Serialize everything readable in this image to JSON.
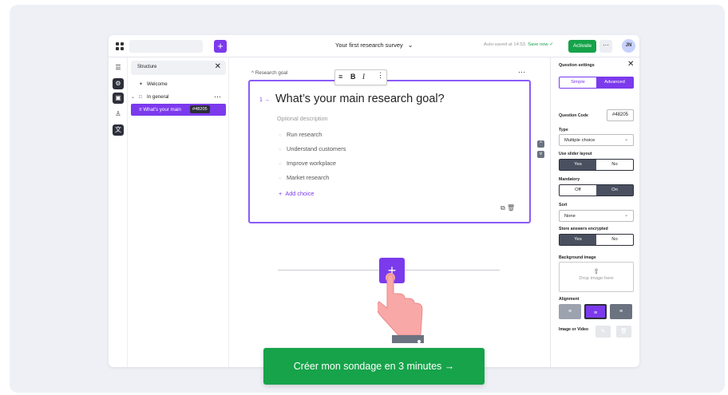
{
  "topbar": {
    "survey_title": "Your first research survey",
    "autosave": "Auto-saved at 14:53.",
    "save_now": "Save now",
    "activate_label": "Activate",
    "more_label": "···",
    "avatar_initials": "JN"
  },
  "structure": {
    "title": "Structure",
    "welcome": "Welcome",
    "in_general": "In general",
    "selected_label": "What's your main",
    "selected_tag": "#48205"
  },
  "question": {
    "group_label": "Research goal",
    "number": "1 →",
    "title": "What’s your main research goal?",
    "description_placeholder": "Optional description",
    "choices": [
      "Run research",
      "Understand customers",
      "Improve workplace",
      "Market research"
    ],
    "add_choice": "Add choice"
  },
  "settings": {
    "title": "Question settings",
    "mode_simple": "Simple",
    "mode_advanced": "Advanced",
    "question_code_label": "Question Code",
    "question_code_value": "#48205",
    "type_label": "Type",
    "type_value": "Multiple choice",
    "slider_label": "Use slider layout",
    "yes": "Yes",
    "no": "No",
    "mandatory_label": "Mandatory",
    "off": "Off",
    "on": "On",
    "sort_label": "Sort",
    "sort_value": "None",
    "encrypt_label": "Store answers encrypted",
    "bg_image_label": "Background image",
    "drop_image": "Drop image here",
    "alignment_label": "Alignment",
    "image_video_label": "Image or Video"
  },
  "cta": {
    "label": "Créer mon sondage en 3 minutes →"
  },
  "colors": {
    "accent": "#7c3aed",
    "success": "#16a34a",
    "dark": "#2d2f3a"
  }
}
